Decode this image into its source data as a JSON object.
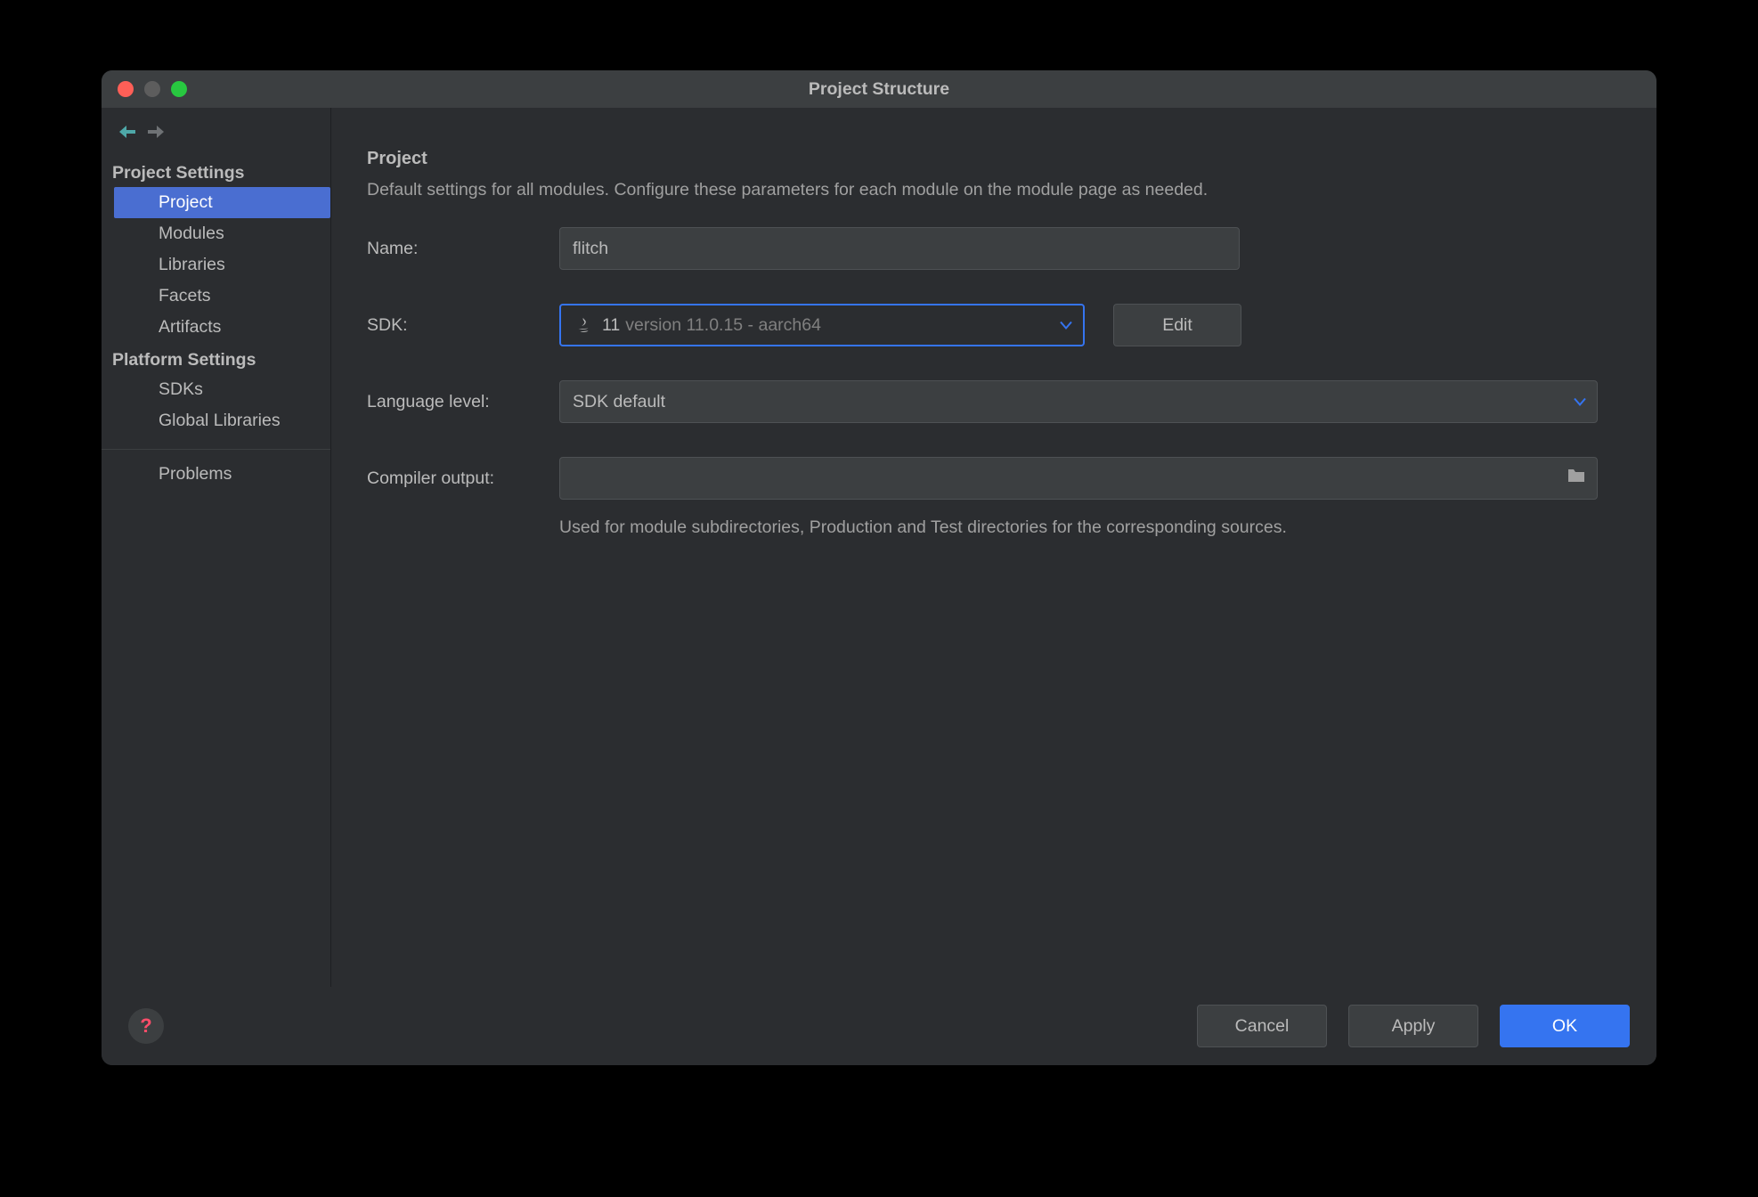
{
  "window": {
    "title": "Project Structure"
  },
  "sidebar": {
    "groups": [
      {
        "label": "Project Settings",
        "items": [
          "Project",
          "Modules",
          "Libraries",
          "Facets",
          "Artifacts"
        ]
      },
      {
        "label": "Platform Settings",
        "items": [
          "SDKs",
          "Global Libraries"
        ]
      }
    ],
    "extra": [
      "Problems"
    ],
    "selected": "Project"
  },
  "page": {
    "title": "Project",
    "description": "Default settings for all modules. Configure these parameters for each module on the module page as needed.",
    "name_label": "Name:",
    "name_value": "flitch",
    "sdk_label": "SDK:",
    "sdk_value": "11",
    "sdk_version": "version 11.0.15 - aarch64",
    "edit_label": "Edit",
    "lang_label": "Language level:",
    "lang_value": "SDK default",
    "output_label": "Compiler output:",
    "output_value": "",
    "output_helper": "Used for module subdirectories, Production and Test directories for the corresponding sources."
  },
  "footer": {
    "cancel": "Cancel",
    "apply": "Apply",
    "ok": "OK"
  }
}
